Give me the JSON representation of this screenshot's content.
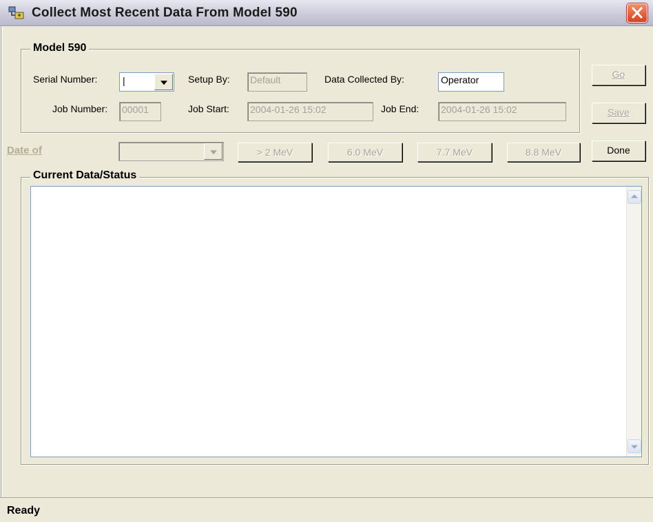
{
  "window": {
    "title": "Collect Most Recent Data From Model 590"
  },
  "group_model": {
    "legend": "Model 590",
    "serial_label": "Serial Number:",
    "serial_value": "|",
    "setup_label": "Setup By:",
    "setup_value": "Default",
    "collected_label": "Data Collected By:",
    "collected_value": "Operator",
    "job_number_label": "Job Number:",
    "job_number_value": "00001",
    "job_start_label": "Job Start:",
    "job_start_value": "2004-01-26  15:02",
    "job_end_label": "Job End:",
    "job_end_value": "2004-01-26  15:02"
  },
  "buttons": {
    "go": "Go",
    "save": "Save",
    "done": "Done",
    "mev_2": "> 2 MeV",
    "mev_6": "6.0 MeV",
    "mev_7": "7.7 MeV",
    "mev_8": "8.8 MeV"
  },
  "date_of": {
    "label": "Date of",
    "value": ""
  },
  "group_status": {
    "legend": "Current Data/Status",
    "content": ""
  },
  "statusbar": {
    "text": "Ready"
  },
  "icons": {
    "app": "app-icon",
    "close": "close-icon"
  }
}
